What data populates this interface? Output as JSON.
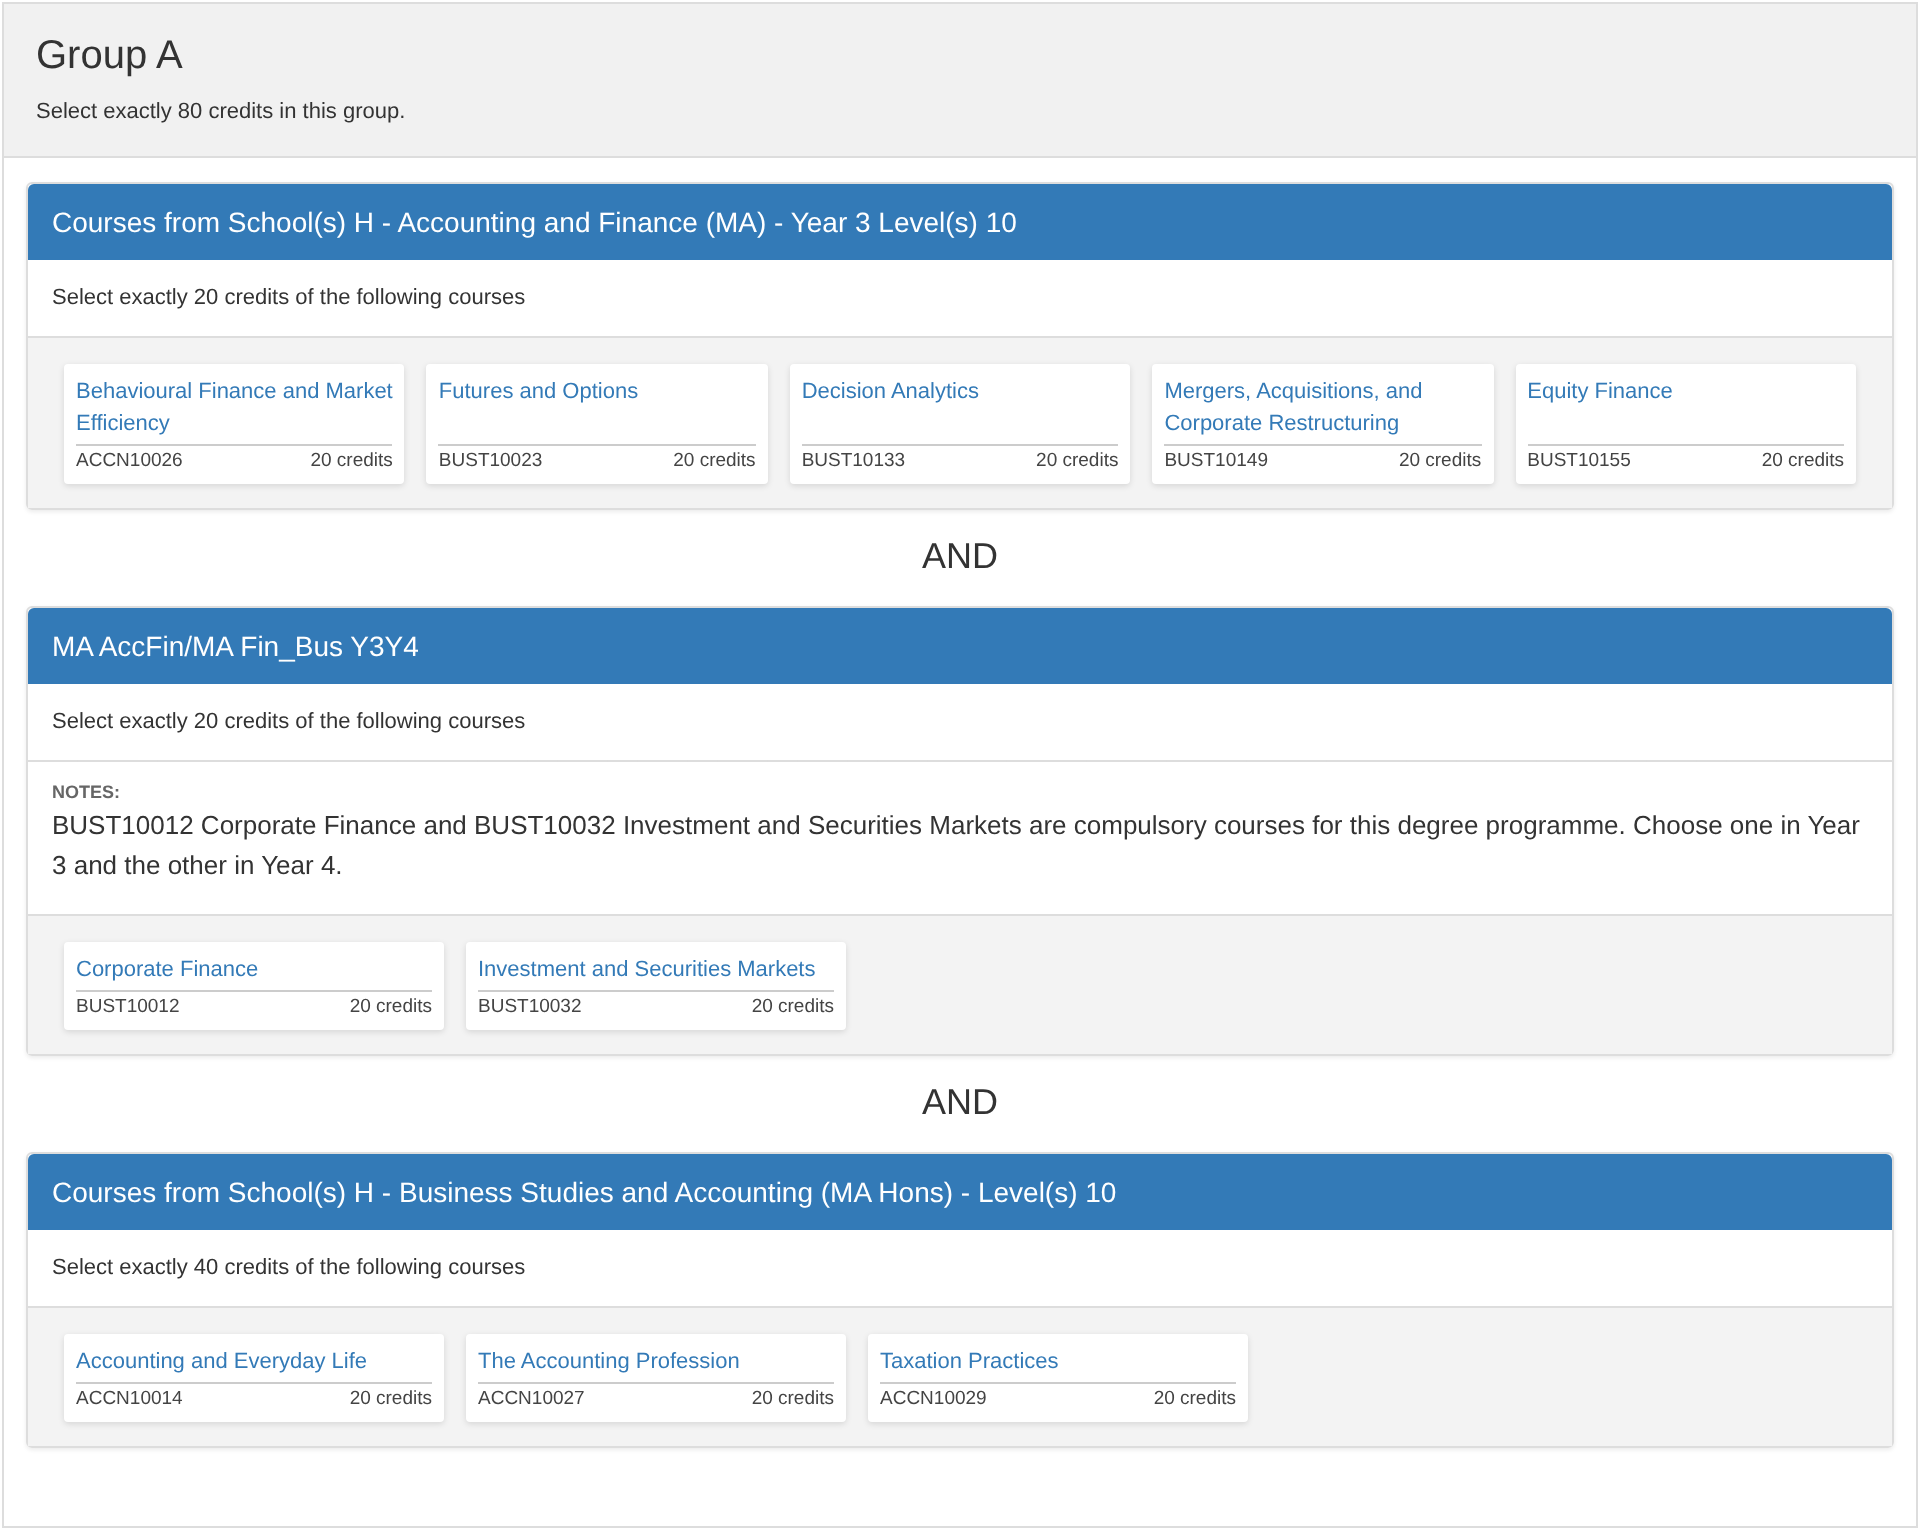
{
  "group": {
    "title": "Group A",
    "instruction": "Select exactly 80 credits in this group."
  },
  "blocks": [
    {
      "title": "Courses from School(s) H - Accounting and Finance (MA) - Year 3 Level(s) 10",
      "instruction": "Select exactly 20 credits of the following courses",
      "courses": [
        {
          "name": "Behavioural Finance and Market Efficiency",
          "code": "ACCN10026",
          "credits": "20 credits"
        },
        {
          "name": "Futures and Options",
          "code": "BUST10023",
          "credits": "20 credits"
        },
        {
          "name": "Decision Analytics",
          "code": "BUST10133",
          "credits": "20 credits"
        },
        {
          "name": "Mergers, Acquisitions, and Corporate Restructuring",
          "code": "BUST10149",
          "credits": "20 credits"
        },
        {
          "name": "Equity Finance",
          "code": "BUST10155",
          "credits": "20 credits"
        }
      ]
    },
    {
      "connector": "AND",
      "title": "MA AccFin/MA Fin_Bus Y3Y4",
      "instruction": "Select exactly 20 credits of the following courses",
      "notes_label": "NOTES:",
      "notes": "BUST10012 Corporate Finance and BUST10032 Investment and Securities Markets are compulsory courses for this degree programme. Choose one in Year 3 and the other in Year 4.",
      "courses": [
        {
          "name": "Corporate Finance",
          "code": "BUST10012",
          "credits": "20 credits"
        },
        {
          "name": "Investment and Securities Markets",
          "code": "BUST10032",
          "credits": "20 credits"
        }
      ]
    },
    {
      "connector": "AND",
      "title": "Courses from School(s) H - Business Studies and Accounting (MA Hons) - Level(s) 10",
      "instruction": "Select exactly 40 credits of the following courses",
      "courses": [
        {
          "name": "Accounting and Everyday Life",
          "code": "ACCN10014",
          "credits": "20 credits"
        },
        {
          "name": "The Accounting Profession",
          "code": "ACCN10027",
          "credits": "20 credits"
        },
        {
          "name": "Taxation Practices",
          "code": "ACCN10029",
          "credits": "20 credits"
        }
      ]
    }
  ]
}
